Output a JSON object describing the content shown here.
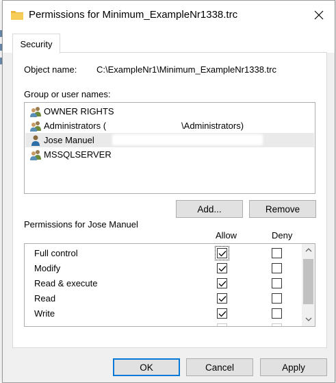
{
  "window": {
    "title": "Permissions for Minimum_ExampleNr1338.trc"
  },
  "tabs": [
    {
      "label": "Security"
    }
  ],
  "object": {
    "label": "Object name:",
    "value": "C:\\ExampleNr1\\Minimum_ExampleNr1338.trc"
  },
  "groups": {
    "label": "Group or user names:",
    "items": [
      {
        "label": "OWNER RIGHTS",
        "icon": "users-icon"
      },
      {
        "label": "Administrators (",
        "suffix": "\\Administrators)",
        "icon": "users-icon"
      },
      {
        "label": "Jose Manuel",
        "icon": "user-icon",
        "selected": true
      },
      {
        "label": "MSSQLSERVER",
        "icon": "users-icon"
      }
    ]
  },
  "buttons": {
    "add": "Add...",
    "remove": "Remove",
    "ok": "OK",
    "cancel": "Cancel",
    "apply": "Apply"
  },
  "permissions": {
    "label": "Permissions for Jose Manuel",
    "allow_header": "Allow",
    "deny_header": "Deny",
    "rows": [
      {
        "name": "Full control",
        "allow": true,
        "deny": false
      },
      {
        "name": "Modify",
        "allow": true,
        "deny": false
      },
      {
        "name": "Read & execute",
        "allow": true,
        "deny": false
      },
      {
        "name": "Read",
        "allow": true,
        "deny": false
      },
      {
        "name": "Write",
        "allow": true,
        "deny": false
      }
    ]
  },
  "colors": {
    "accent": "#0078d7",
    "selection": "#eaeaea",
    "button_face": "#e1e1e1"
  }
}
